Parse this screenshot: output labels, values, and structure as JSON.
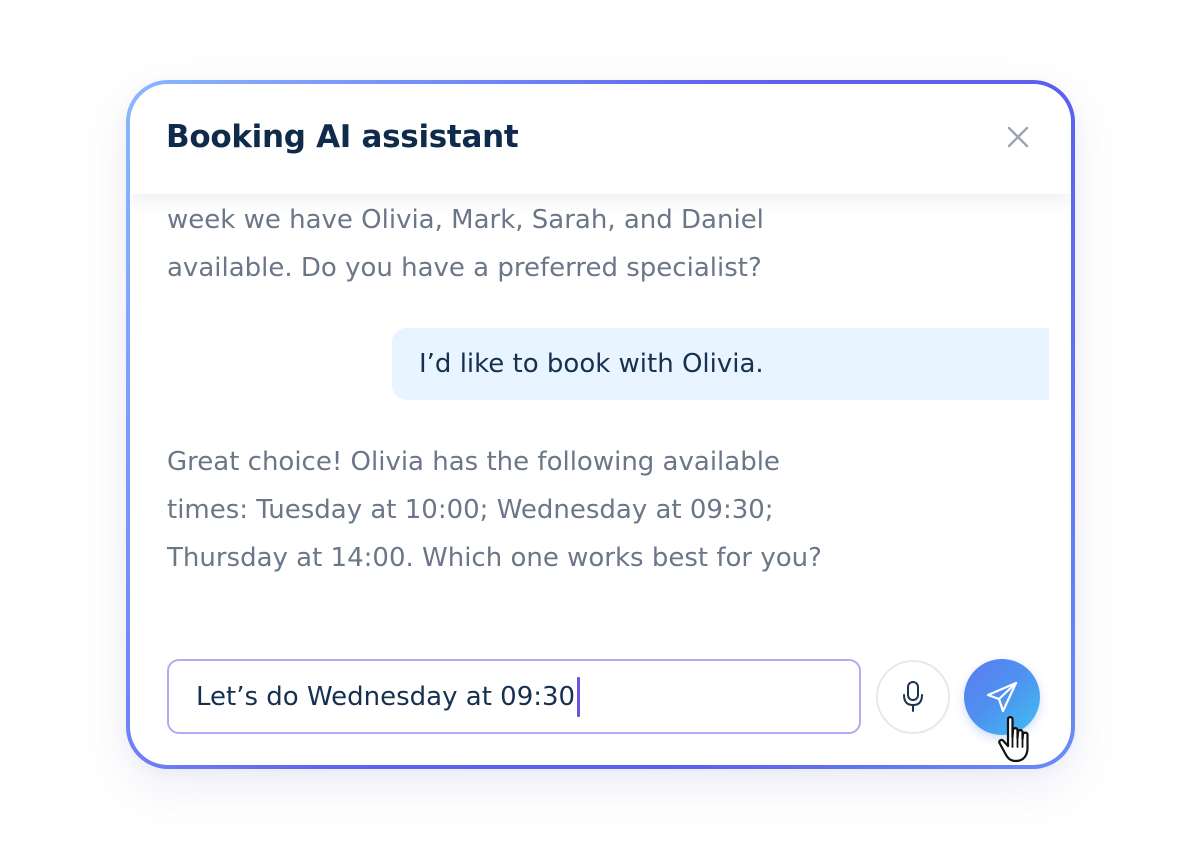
{
  "app": {
    "title": "Booking AI assistant"
  },
  "messages": {
    "top_lines": [
      "week we have Olivia, Mark, Sarah, and Daniel",
      "available. Do you have a preferred specialist?"
    ],
    "user_reply": "I’d like to book with Olivia.",
    "assistant_reply_lines": [
      "Great choice! Olivia has the following available",
      "times: Tuesday at 10:00; Wednesday at 09:30;",
      "Thursday at 14:00. Which one works best for you?"
    ]
  },
  "composer": {
    "input_value": "Let’s do Wednesday at 09:30"
  },
  "icons": {
    "close": "close-icon",
    "mic": "microphone-icon",
    "send": "paper-plane-icon",
    "pointer": "hand-pointer-icon"
  },
  "colors": {
    "title": "#0f2a4a",
    "assistant_text": "#6b7789",
    "user_bubble": "#e8f4ff",
    "input_border": "#b7a8f4",
    "send_gradient_start": "#5e7df2",
    "send_gradient_end": "#3fc0f0",
    "frame_gradient": "#5f63f2"
  }
}
